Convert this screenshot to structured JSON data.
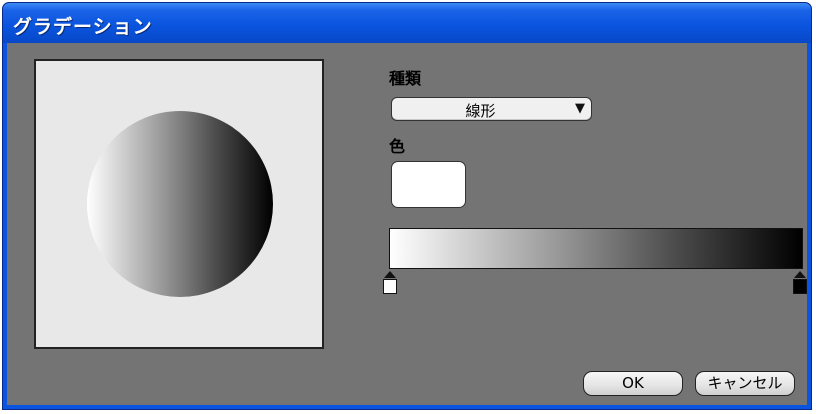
{
  "window": {
    "title": "グラデーション"
  },
  "form": {
    "type_label": "種類",
    "type_value": "線形",
    "color_label": "色",
    "selected_color": "#ffffff"
  },
  "gradient": {
    "stops": [
      {
        "position": 0,
        "color": "#ffffff"
      },
      {
        "position": 1,
        "color": "#000000"
      }
    ]
  },
  "buttons": {
    "ok": "OK",
    "cancel": "キャンセル"
  },
  "colors": {
    "titlebar": "#0a55df",
    "client_bg": "#747474",
    "preview_bg": "#e8e8e8"
  }
}
